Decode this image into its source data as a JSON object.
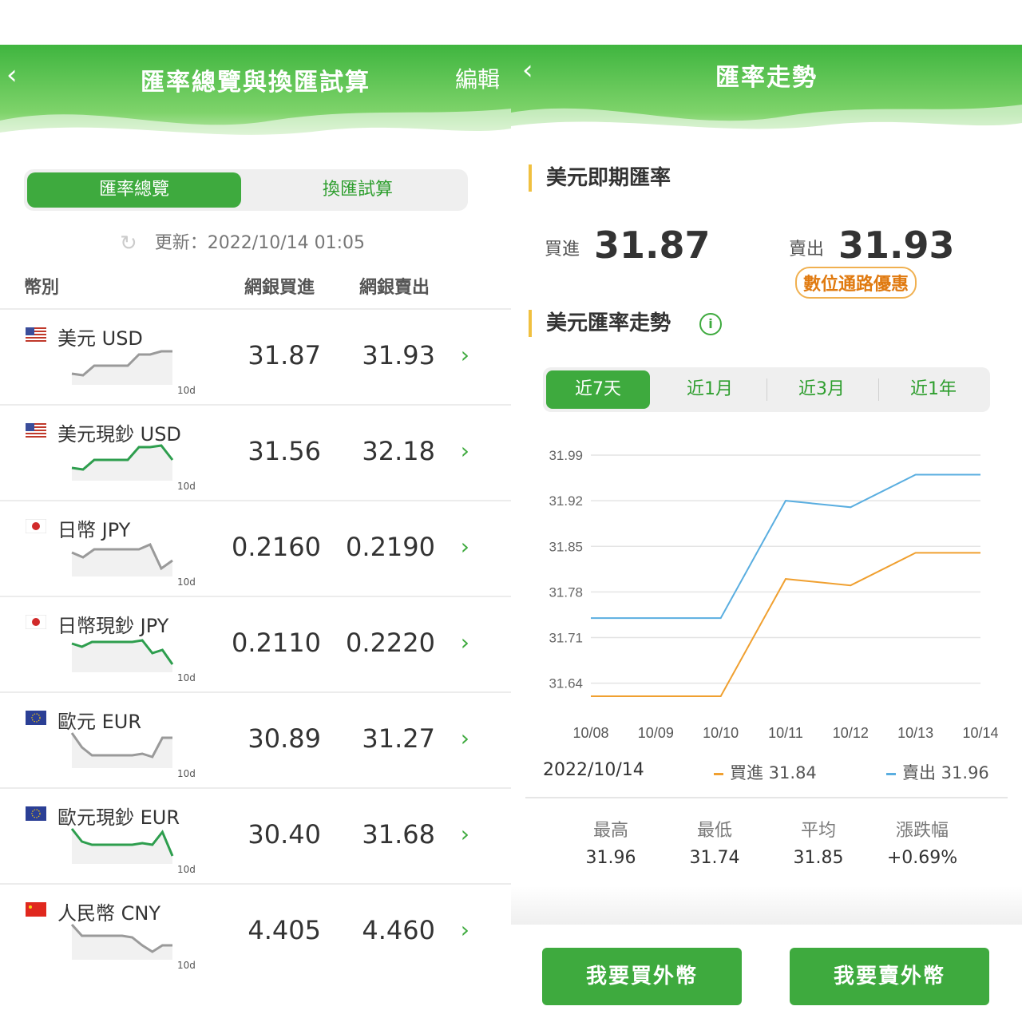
{
  "left": {
    "header": {
      "back": "‹",
      "title": "匯率總覽與換匯試算",
      "edit": "編輯"
    },
    "tabs": [
      "匯率總覽",
      "換匯試算"
    ],
    "update_text": "更新：2022/10/14 01:05",
    "columns": {
      "currency": "幣別",
      "buy": "網銀買進",
      "sell": "網銀賣出"
    },
    "rows": [
      {
        "name": "美元 USD",
        "flag": "us",
        "buy": "31.87",
        "sell": "31.93",
        "spark_color": "#9a9a9a",
        "spark": [
          0.2,
          0.15,
          0.45,
          0.45,
          0.45,
          0.45,
          0.8,
          0.8,
          0.9,
          0.9
        ],
        "tag": "10d"
      },
      {
        "name": "美元現鈔 USD",
        "flag": "us",
        "buy": "31.56",
        "sell": "32.18",
        "spark_color": "#2e9e4e",
        "spark": [
          0.25,
          0.2,
          0.5,
          0.5,
          0.5,
          0.5,
          0.9,
          0.9,
          0.95,
          0.5
        ],
        "tag": "10d"
      },
      {
        "name": "日幣 JPY",
        "flag": "jp",
        "buy": "0.2160",
        "sell": "0.2190",
        "spark_color": "#9a9a9a",
        "spark": [
          0.6,
          0.45,
          0.7,
          0.7,
          0.7,
          0.7,
          0.7,
          0.85,
          0.1,
          0.35
        ],
        "tag": "10d"
      },
      {
        "name": "日幣現鈔 JPY",
        "flag": "jp",
        "buy": "0.2110",
        "sell": "0.2220",
        "spark_color": "#2e9e4e",
        "spark": [
          0.75,
          0.65,
          0.8,
          0.8,
          0.8,
          0.8,
          0.8,
          0.85,
          0.45,
          0.55,
          0.1
        ],
        "tag": "10d"
      },
      {
        "name": "歐元 EUR",
        "flag": "eu",
        "buy": "30.89",
        "sell": "31.27",
        "spark_color": "#9a9a9a",
        "spark": [
          0.95,
          0.5,
          0.25,
          0.25,
          0.25,
          0.25,
          0.25,
          0.3,
          0.2,
          0.8,
          0.8
        ],
        "tag": "10d"
      },
      {
        "name": "歐元現鈔 EUR",
        "flag": "eu",
        "buy": "30.40",
        "sell": "31.68",
        "spark_color": "#2e9e4e",
        "spark": [
          0.95,
          0.55,
          0.45,
          0.45,
          0.45,
          0.45,
          0.45,
          0.5,
          0.45,
          0.85,
          0.1
        ],
        "tag": "10d"
      },
      {
        "name": "人民幣 CNY",
        "flag": "cn",
        "buy": "4.405",
        "sell": "4.460",
        "spark_color": "#9a9a9a",
        "spark": [
          0.95,
          0.6,
          0.6,
          0.6,
          0.6,
          0.6,
          0.55,
          0.3,
          0.1,
          0.3,
          0.3
        ],
        "tag": "10d"
      }
    ]
  },
  "right": {
    "header": {
      "back": "‹",
      "title": "匯率走勢"
    },
    "spot_title": "美元即期匯率",
    "buy_label": "買進",
    "buy_value": "31.87",
    "sell_label": "賣出",
    "sell_value": "31.93",
    "badge": "數位通路優惠",
    "trend_title": "美元匯率走勢",
    "info_icon": "i",
    "ranges": [
      "近7天",
      "近1月",
      "近3月",
      "近1年"
    ],
    "legend": {
      "date": "2022/10/14",
      "buy": "買進 31.84",
      "sell": "賣出 31.96"
    },
    "stats": [
      {
        "label": "最高",
        "value": "31.96"
      },
      {
        "label": "最低",
        "value": "31.74"
      },
      {
        "label": "平均",
        "value": "31.85"
      },
      {
        "label": "漲跌幅",
        "value": "+0.69%"
      }
    ],
    "actions": {
      "buy": "我要買外幣",
      "sell": "我要賣外幣"
    }
  },
  "colors": {
    "brand_green": "#3eaa3e",
    "buy_line": "#f0a030",
    "sell_line": "#5aaee0",
    "badge_orange": "#e07a10"
  },
  "chart_data": {
    "type": "line",
    "x": [
      "10/08",
      "10/09",
      "10/10",
      "10/11",
      "10/12",
      "10/13",
      "10/14"
    ],
    "y_ticks": [
      "31.99",
      "31.92",
      "31.85",
      "31.78",
      "31.71",
      "31.64"
    ],
    "ylim": [
      31.62,
      31.99
    ],
    "series": [
      {
        "name": "買進",
        "color": "#f0a030",
        "values": [
          31.62,
          31.62,
          31.62,
          31.8,
          31.79,
          31.84,
          31.84
        ]
      },
      {
        "name": "賣出",
        "color": "#5aaee0",
        "values": [
          31.74,
          31.74,
          31.74,
          31.92,
          31.91,
          31.96,
          31.96
        ]
      }
    ]
  }
}
